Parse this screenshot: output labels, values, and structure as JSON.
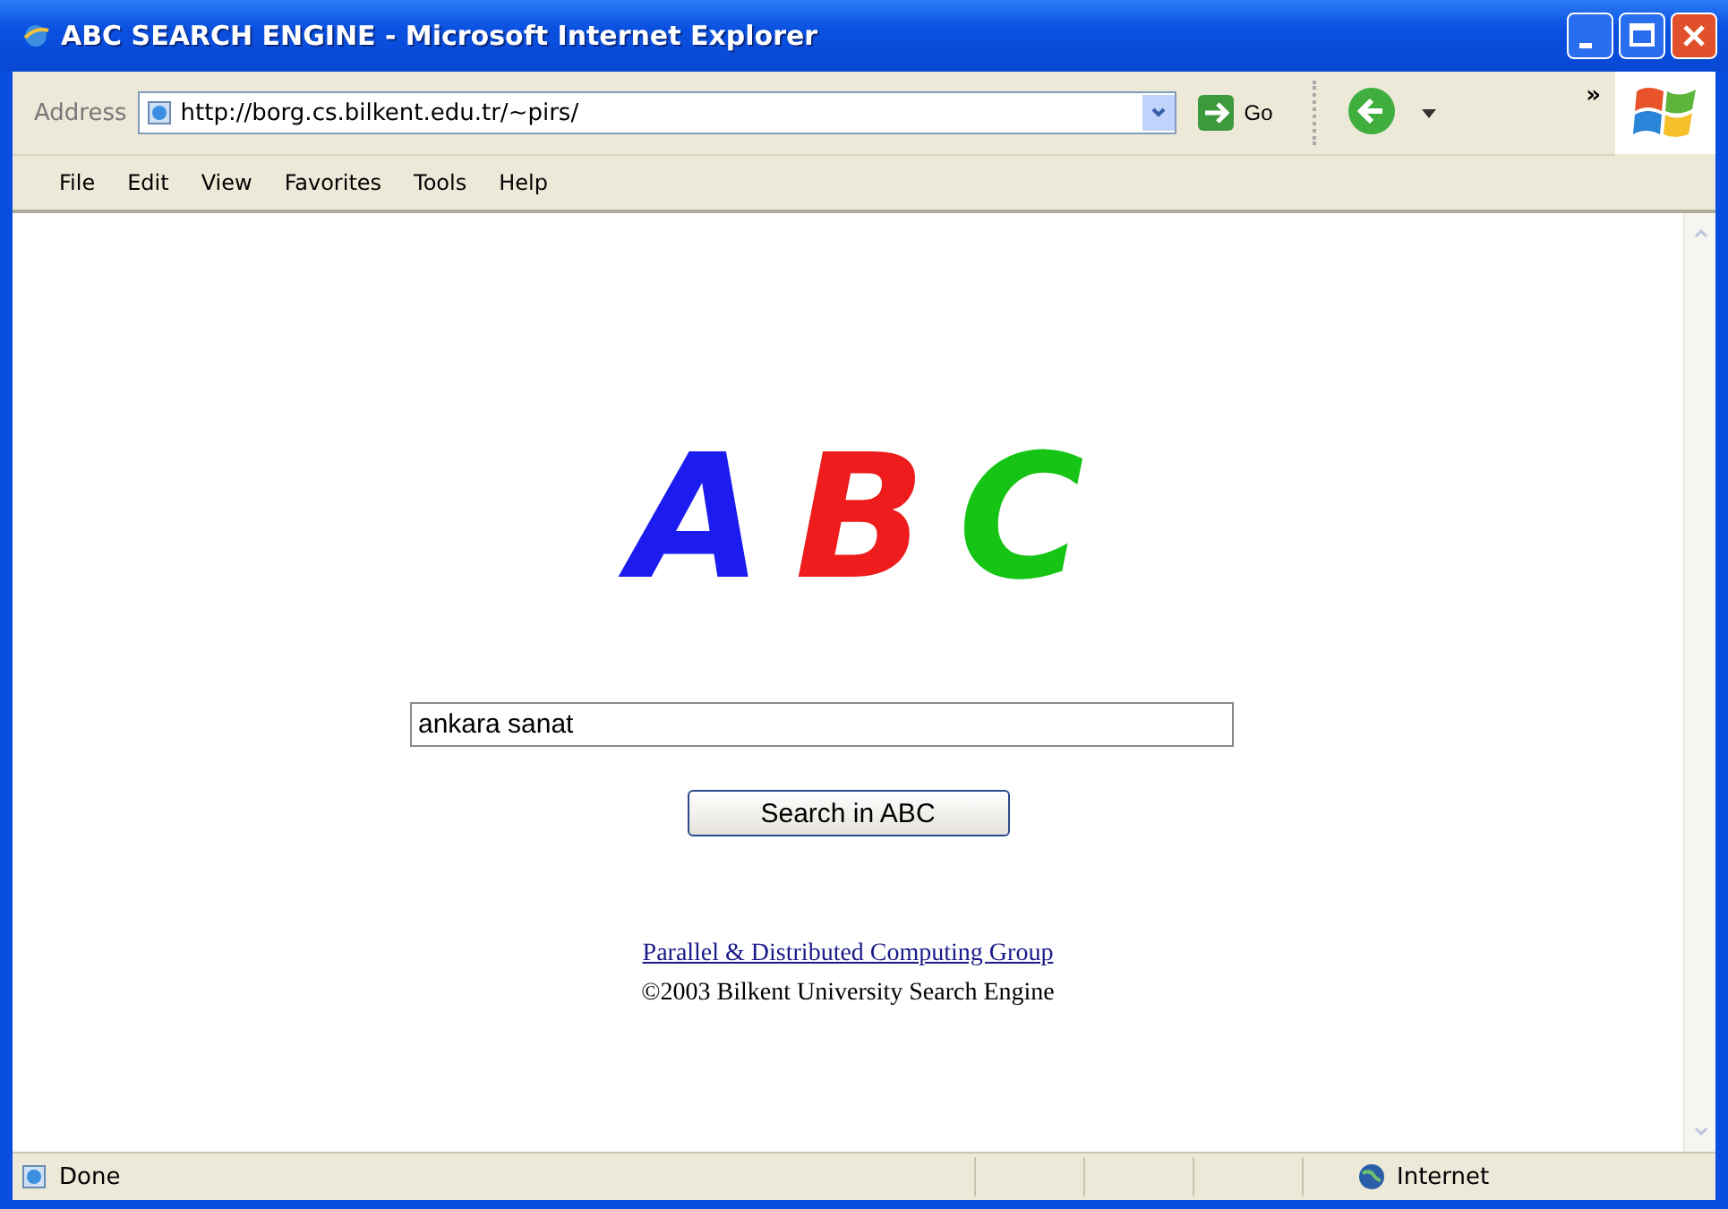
{
  "window": {
    "title": "ABC SEARCH ENGINE - Microsoft Internet Explorer"
  },
  "address_bar": {
    "label": "Address",
    "url": "http://borg.cs.bilkent.edu.tr/~pirs/",
    "go": "Go",
    "overflow": "»"
  },
  "menu": [
    "File",
    "Edit",
    "View",
    "Favorites",
    "Tools",
    "Help"
  ],
  "page": {
    "logo": [
      {
        "text": "A",
        "color": "#1c1cf0"
      },
      {
        "text": "B",
        "color": "#ee1c1c"
      },
      {
        "text": "C",
        "color": "#16c416"
      }
    ],
    "search": {
      "value": "ankara sanat"
    },
    "button": "Search in ABC",
    "link": "Parallel & Distributed Computing Group",
    "footer": "©2003 Bilkent University Search Engine"
  },
  "status_bar": {
    "text": "Done",
    "zone": "Internet"
  }
}
